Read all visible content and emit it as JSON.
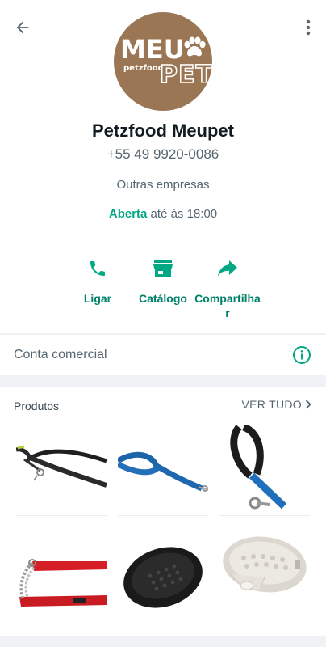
{
  "header": {
    "back_icon": "arrow-left-icon",
    "menu_icon": "more-vertical-icon"
  },
  "logo": {
    "line1": "MEU",
    "brand": "petzfood",
    "line2": "PET",
    "color": "#9b7654"
  },
  "profile": {
    "name": "Petzfood Meupet",
    "phone": "+55 49 9920-0086",
    "category": "Outras empresas",
    "status_open": "Aberta",
    "status_hours": " até às 18:00"
  },
  "actions": [
    {
      "label": "Ligar",
      "icon": "phone-icon"
    },
    {
      "label": "Catálogo",
      "icon": "storefront-icon"
    },
    {
      "label": "Compartilhar",
      "icon": "share-icon"
    }
  ],
  "account": {
    "label": "Conta comercial",
    "icon": "info-icon"
  },
  "products": {
    "title": "Produtos",
    "see_all": "VER TUDO",
    "items": [
      {
        "icon": "black-leash-product"
      },
      {
        "icon": "blue-leash-product"
      },
      {
        "icon": "blue-handle-leash-product"
      },
      {
        "icon": "red-choke-collar-product"
      },
      {
        "icon": "black-grooming-brush-product"
      },
      {
        "icon": "white-grooming-brush-product"
      }
    ]
  },
  "colors": {
    "accent": "#00a884",
    "accent_dark": "#008069",
    "text_secondary": "#54656f"
  }
}
